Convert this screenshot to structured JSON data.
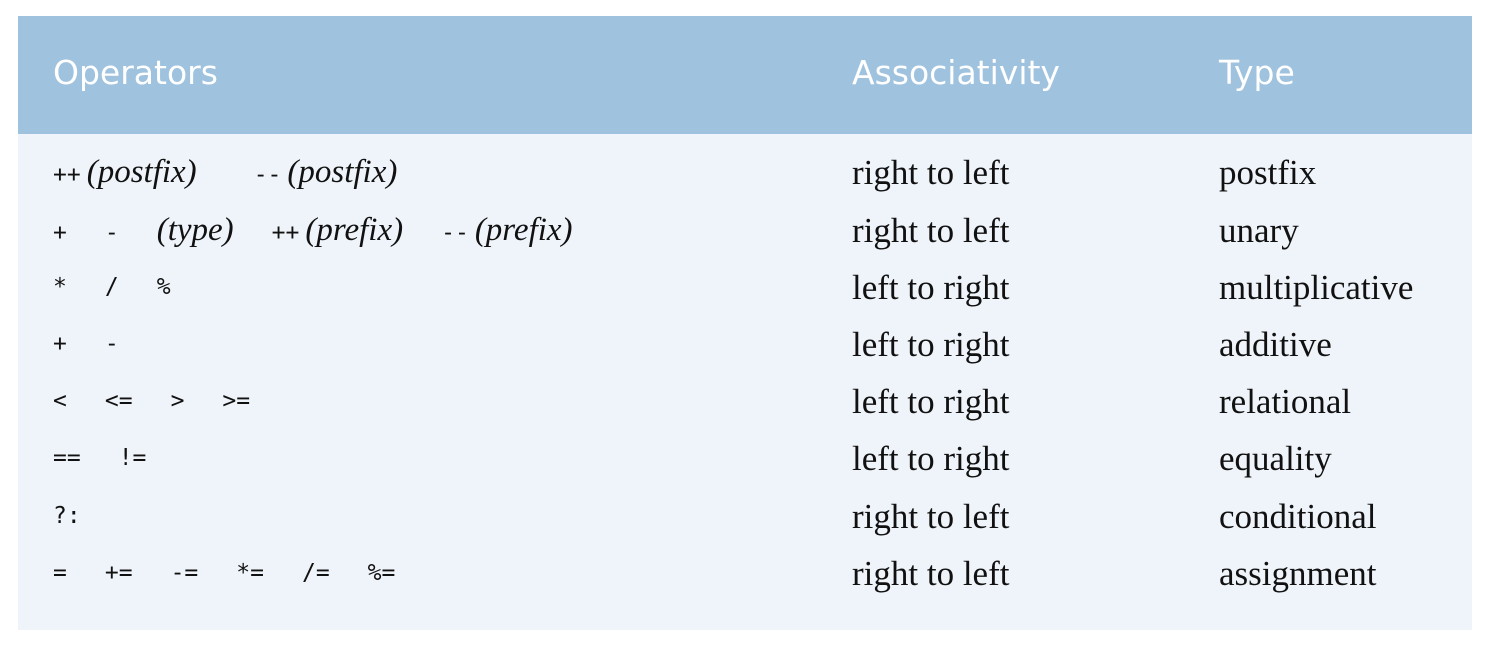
{
  "header": {
    "operators": "Operators",
    "associativity": "Associativity",
    "type": "Type"
  },
  "rows": [
    {
      "ops": [
        {
          "tok": "++",
          "note": "(postfix)"
        },
        {
          "tok": "--",
          "note": "(postfix)"
        }
      ],
      "associativity": "right to left",
      "type": "postfix"
    },
    {
      "ops": [
        {
          "tok": "+"
        },
        {
          "tok": "-"
        },
        {
          "note": "(type)"
        },
        {
          "tok": "++",
          "note": "(prefix)"
        },
        {
          "tok": "--",
          "note": "(prefix)"
        }
      ],
      "associativity": "right to left",
      "type": "unary"
    },
    {
      "ops": [
        {
          "tok": "*"
        },
        {
          "tok": "/"
        },
        {
          "tok": "%"
        }
      ],
      "associativity": "left to right",
      "type": "multiplicative"
    },
    {
      "ops": [
        {
          "tok": "+"
        },
        {
          "tok": "-"
        }
      ],
      "associativity": "left to right",
      "type": "additive"
    },
    {
      "ops": [
        {
          "tok": "<"
        },
        {
          "tok": "<="
        },
        {
          "tok": ">"
        },
        {
          "tok": ">="
        }
      ],
      "associativity": "left to right",
      "type": "relational"
    },
    {
      "ops": [
        {
          "tok": "=="
        },
        {
          "tok": "!="
        }
      ],
      "associativity": "left to right",
      "type": "equality"
    },
    {
      "ops": [
        {
          "tok": "?:"
        }
      ],
      "associativity": "right to left",
      "type": "conditional"
    },
    {
      "ops": [
        {
          "tok": "="
        },
        {
          "tok": "+="
        },
        {
          "tok": "-="
        },
        {
          "tok": "*="
        },
        {
          "tok": "/="
        },
        {
          "tok": "%="
        }
      ],
      "associativity": "right to left",
      "type": "assignment"
    }
  ]
}
